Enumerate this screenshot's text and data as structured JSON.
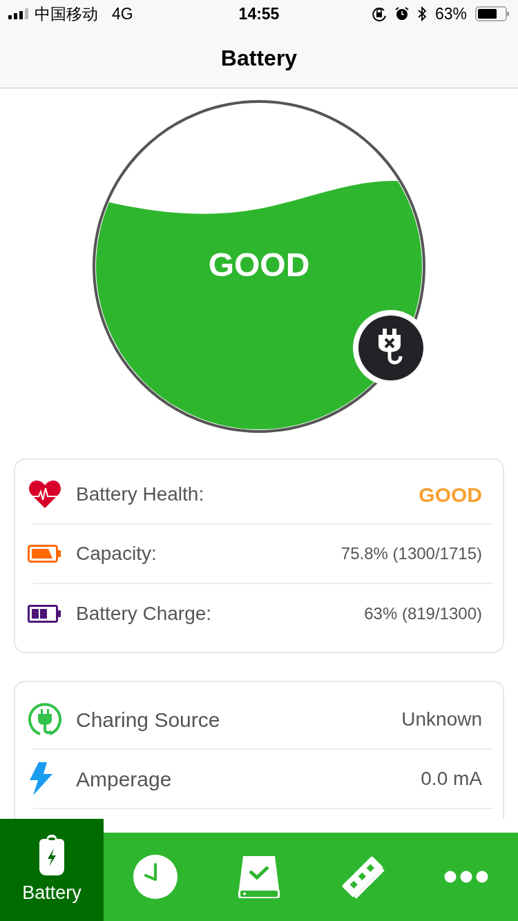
{
  "status_bar": {
    "carrier": "中国移动",
    "network": "4G",
    "time": "14:55",
    "battery": "63%"
  },
  "nav": {
    "title": "Battery"
  },
  "gauge": {
    "label": "GOOD",
    "plugged": false
  },
  "cards": [
    {
      "rows": [
        {
          "kind": "heart",
          "label": "Battery Health:",
          "value": "GOOD",
          "emphasis": true
        },
        {
          "kind": "capacity",
          "label": "Capacity:",
          "value": "75.8% (1300/1715)",
          "emphasis": false
        },
        {
          "kind": "charge",
          "label": "Battery Charge:",
          "value": "63% (819/1300)",
          "emphasis": false
        }
      ]
    },
    {
      "rows": [
        {
          "kind": "plug",
          "label": "Charing Source",
          "value": "Unknown",
          "emphasis": false
        },
        {
          "kind": "bolt",
          "label": "Amperage",
          "value": "0.0 mA",
          "emphasis": false
        }
      ]
    }
  ],
  "tabs": [
    {
      "kind": "battery",
      "label": "Battery",
      "selected": true
    },
    {
      "kind": "history",
      "selected": false
    },
    {
      "kind": "storage",
      "selected": false
    },
    {
      "kind": "memory",
      "selected": false
    },
    {
      "kind": "more",
      "selected": false
    }
  ]
}
